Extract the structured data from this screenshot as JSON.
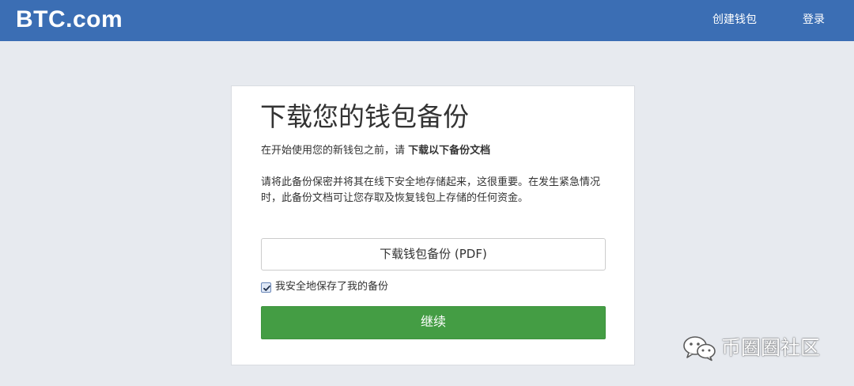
{
  "header": {
    "logo": "BTC.com",
    "nav": {
      "create_wallet": "创建钱包",
      "login": "登录"
    }
  },
  "card": {
    "title": "下载您的钱包备份",
    "intro_prefix": "在开始使用您的新钱包之前，请 ",
    "intro_bold": "下载以下备份文档",
    "description": "请将此备份保密并将其在线下安全地存储起来，这很重要。在发生紧急情况时，此备份文档可让您存取及恢复钱包上存储的任何资金。",
    "download_button": "下载钱包备份 (PDF)",
    "confirm_checkbox": {
      "label": "我安全地保存了我的备份",
      "checked": true
    },
    "continue_button": "继续"
  },
  "watermark": {
    "icon": "wechat-icon",
    "text": "币圈圈社区"
  },
  "colors": {
    "header_bg": "#3b6eb4",
    "page_bg": "#e7eaef",
    "continue_bg": "#449d44"
  }
}
